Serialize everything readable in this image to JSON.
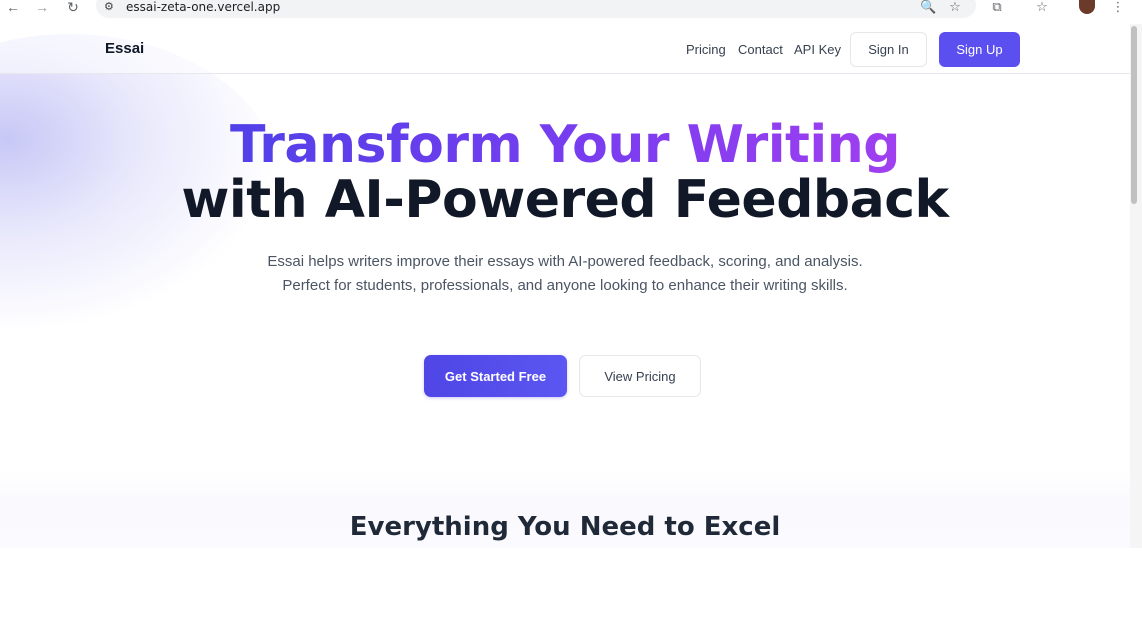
{
  "browser": {
    "back_icon": "←",
    "forward_icon": "→",
    "reload_icon": "↻",
    "site_info_icon": "⚙",
    "url": "essai-zeta-one.vercel.app",
    "zoom_icon": "🔍",
    "bookmark_icon": "☆",
    "extensions_icon": "⧉",
    "bookmarks_bar_icon": "☆",
    "menu_icon": "⋮"
  },
  "header": {
    "brand": "Essai",
    "nav": [
      "Pricing",
      "Contact",
      "API Key"
    ],
    "sign_in": "Sign In",
    "sign_up": "Sign Up"
  },
  "hero": {
    "title_line1": "Transform Your Writing",
    "title_line2": "with AI-Powered Feedback",
    "description": "Essai helps writers improve their essays with AI-powered feedback, scoring, and analysis. Perfect for students, professionals, and anyone looking to enhance their writing skills.",
    "primary_cta": "Get Started Free",
    "secondary_cta": "View Pricing"
  },
  "features": {
    "title": "Everything You Need to Excel"
  },
  "colors": {
    "accent": "#5b4ff0",
    "gradient_start": "#5140e8",
    "gradient_end": "#a03ff0",
    "heading": "#111827"
  }
}
